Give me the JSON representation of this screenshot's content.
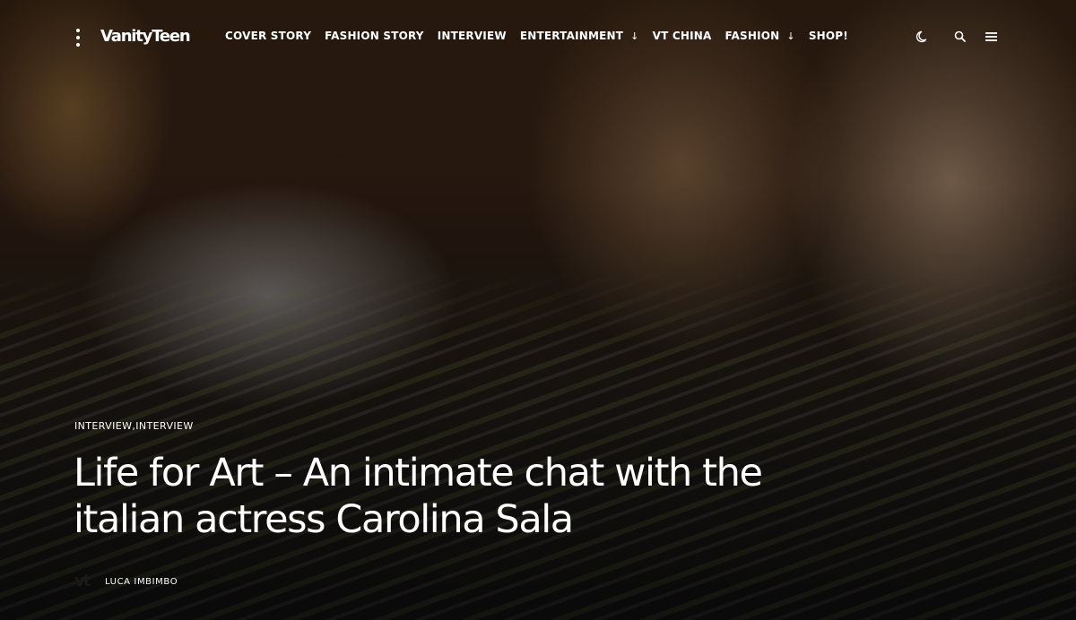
{
  "site": {
    "logo": "VanityTeen"
  },
  "nav": {
    "items": [
      {
        "label": "COVER STORY",
        "has_dropdown": false
      },
      {
        "label": "FASHION STORY",
        "has_dropdown": false
      },
      {
        "label": "INTERVIEW",
        "has_dropdown": false
      },
      {
        "label": "ENTERTAINMENT",
        "has_dropdown": true
      },
      {
        "label": "VT CHINA",
        "has_dropdown": false
      },
      {
        "label": "FASHION",
        "has_dropdown": true
      },
      {
        "label": "SHOP!",
        "has_dropdown": false
      }
    ],
    "dropdown_glyph": "↓"
  },
  "tools": {
    "icons": [
      "dark-mode-moon-icon",
      "search-icon",
      "hamburger-menu-icon"
    ]
  },
  "article": {
    "category": "INTERVIEW,INTERVIEW",
    "title": "Life for Art – An intimate chat with the italian actress Carolina Sala",
    "author_avatar": "vt",
    "author": "LUCA IMBIMBO"
  },
  "colors": {
    "text": "#ffffff",
    "overlay": "#000000"
  }
}
